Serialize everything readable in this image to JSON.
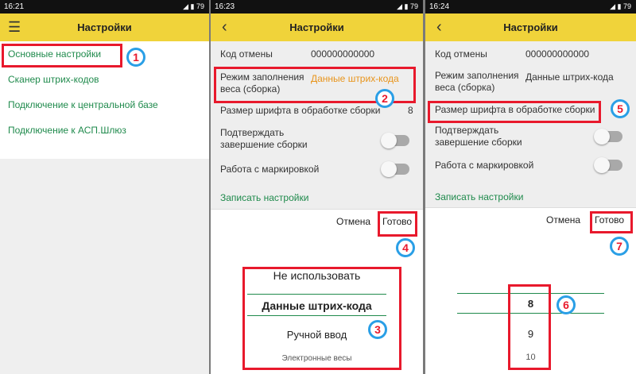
{
  "screen1": {
    "status_time": "16:21",
    "status_icons": "◢ ▮ 79",
    "title": "Настройки",
    "items": [
      "Основные настройки",
      "Сканер штрих-кодов",
      "Подключение к центральной базе",
      "Подключение к АСП.Шлюз"
    ]
  },
  "screen2": {
    "status_time": "16:23",
    "status_icons": "◢ ▮ 79",
    "title": "Настройки",
    "cancel_code_label": "Код отмены",
    "cancel_code_value": "000000000000",
    "weight_mode_label": "Режим заполнения веса (сборка)",
    "weight_mode_value": "Данные штрих-кода",
    "font_size_label": "Размер шрифта в обработке сборки",
    "font_size_value": "8",
    "confirm_label": "Подтверждать завершение сборки",
    "marking_label": "Работа с маркировкой",
    "save_link": "Записать настройки",
    "cancel_btn": "Отмена",
    "done_btn": "Готово",
    "picker_options": [
      "Не использовать",
      "Данные штрих-кода",
      "Ручной ввод",
      "Электронные весы"
    ]
  },
  "screen3": {
    "status_time": "16:24",
    "status_icons": "◢ ▮ 79",
    "title": "Настройки",
    "cancel_code_label": "Код отмены",
    "cancel_code_value": "000000000000",
    "weight_mode_label": "Режим заполнения веса (сборка)",
    "weight_mode_value": "Данные штрих-кода",
    "font_size_label": "Размер шрифта в обработке сборки",
    "confirm_label": "Подтверждать завершение сборки",
    "marking_label": "Работа с маркировкой",
    "save_link": "Записать настройки",
    "cancel_btn": "Отмена",
    "done_btn": "Готово",
    "picker_options": [
      "8",
      "9",
      "10"
    ]
  },
  "annotations": [
    "1",
    "2",
    "3",
    "4",
    "5",
    "6",
    "7"
  ],
  "colors": {
    "accent_yellow": "#f0d33a",
    "link_green": "#1f8a4c",
    "value_orange": "#e8941a",
    "annotation_red": "#e8192c",
    "annotation_blue": "#2a9fe6"
  }
}
